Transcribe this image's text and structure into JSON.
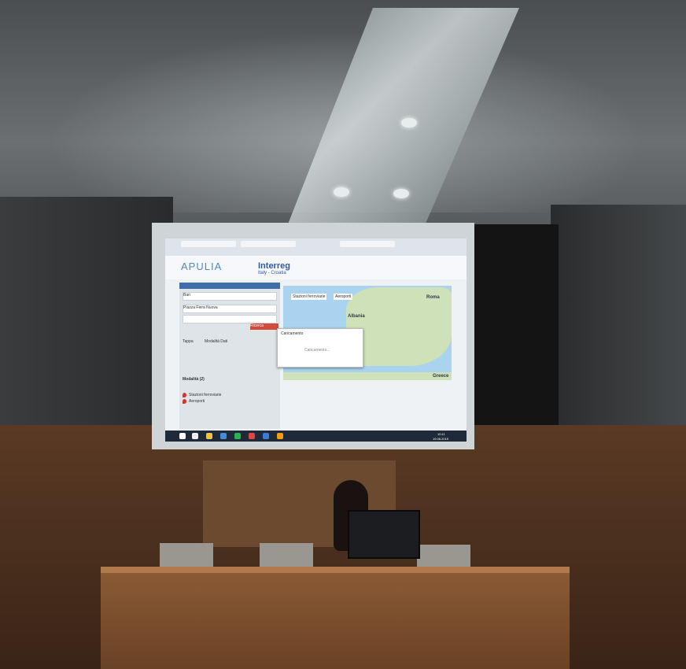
{
  "scene": {
    "description_free": true
  },
  "screen": {
    "header": {
      "apulia_logo": "APULIA",
      "interreg_logo": "Interreg",
      "interreg_sub": "Italy - Croatia"
    },
    "panel": {
      "origin": "Bari",
      "destination": "Piazza Fiera Nuova",
      "button_search": "Ricerca",
      "tabs": [
        "Tappa",
        "Modalità Dati"
      ],
      "section_title": "Modalità (2)",
      "list": [
        "Stazioni ferroviarie",
        "Aeroporti"
      ]
    },
    "map": {
      "chips": [
        "Stazioni ferroviarie",
        "Aeroporti"
      ],
      "labels": {
        "albania": "Albania",
        "greece": "Greece",
        "roma": "Roma"
      }
    },
    "dialog": {
      "title": "Caricamento",
      "body": "Caricamento..."
    },
    "taskbar": {
      "time": "10:11",
      "date": "19.06.2019"
    }
  }
}
